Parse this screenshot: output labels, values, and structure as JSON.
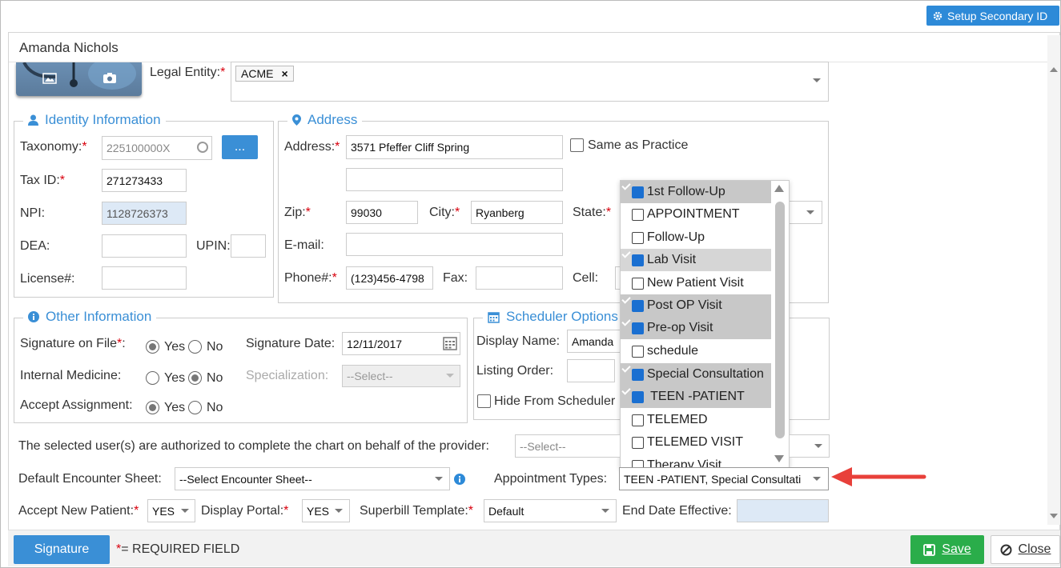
{
  "toolbar": {
    "setup_secondary_id": "Setup Secondary ID"
  },
  "dialog": {
    "title": "Amanda Nichols"
  },
  "legal_entity": {
    "label": "Legal Entity:",
    "required": "*",
    "tag": "ACME",
    "tag_remove": "×"
  },
  "identity": {
    "legend": "Identity Information",
    "taxonomy": {
      "label": "Taxonomy:",
      "value": "225100000X",
      "button": "..."
    },
    "tax_id": {
      "label": "Tax ID:",
      "value": "271273433"
    },
    "npi": {
      "label": "NPI:",
      "value": "1128726373"
    },
    "dea": {
      "label": "DEA:",
      "value": ""
    },
    "upin": {
      "label": "UPIN:",
      "value": ""
    },
    "license": {
      "label": "License#:",
      "value": ""
    }
  },
  "address": {
    "legend": "Address",
    "address": {
      "label": "Address:",
      "value": "3571 Pfeffer Cliff Spring",
      "value2": ""
    },
    "same_as_practice": "Same as Practice",
    "zip": {
      "label": "Zip:",
      "value": "99030"
    },
    "city": {
      "label": "City:",
      "value": "Ryanberg"
    },
    "state": {
      "label": "State:"
    },
    "email": {
      "label": "E-mail:",
      "value": ""
    },
    "phone": {
      "label": "Phone#:",
      "value": "(123)456-4798"
    },
    "fax": {
      "label": "Fax:",
      "value": ""
    },
    "cell": {
      "label": "Cell:"
    }
  },
  "other": {
    "legend": "Other Information",
    "signature_on_file": {
      "label": "Signature on File",
      "selected": "Yes"
    },
    "internal_medicine": {
      "label": "Internal Medicine:",
      "selected": "No"
    },
    "accept_assignment": {
      "label": "Accept Assignment:",
      "selected": "Yes"
    },
    "yes": "Yes",
    "no": "No",
    "signature_date": {
      "label": "Signature Date:",
      "value": "12/11/2017"
    },
    "specialization": {
      "label": "Specialization:",
      "value": "--Select--"
    }
  },
  "scheduler": {
    "legend": "Scheduler Options",
    "display_name": {
      "label": "Display Name:",
      "value": "Amanda"
    },
    "listing_order": {
      "label": "Listing Order:",
      "value": ""
    },
    "hide_from_scheduler": "Hide From Scheduler"
  },
  "appointment_dropdown": {
    "items": [
      {
        "label": "1st Follow-Up",
        "checked": true
      },
      {
        "label": "APPOINTMENT",
        "checked": false
      },
      {
        "label": "Follow-Up",
        "checked": false
      },
      {
        "label": "Lab Visit",
        "checked": true
      },
      {
        "label": "New Patient Visit",
        "checked": false
      },
      {
        "label": "Post OP Visit",
        "checked": true
      },
      {
        "label": "Pre-op Visit",
        "checked": true
      },
      {
        "label": "schedule",
        "checked": false
      },
      {
        "label": "Special Consultation",
        "checked": true
      },
      {
        "label": " TEEN -PATIENT",
        "checked": true
      },
      {
        "label": "TELEMED",
        "checked": false
      },
      {
        "label": "TELEMED VISIT",
        "checked": false
      },
      {
        "label": "Therapy Visit",
        "checked": false
      }
    ]
  },
  "authorized": {
    "label": "The selected user(s) are authorized to complete the chart on behalf of the provider:",
    "value": "--Select--"
  },
  "encounter_sheet": {
    "label": "Default Encounter Sheet:",
    "value": "--Select Encounter Sheet--"
  },
  "appointment_types": {
    "label": "Appointment Types:",
    "value": "TEEN -PATIENT, Special Consultati"
  },
  "accept_new_patient": {
    "label": "Accept New Patient:",
    "value": "YES"
  },
  "display_portal": {
    "label": "Display Portal:",
    "value": "YES"
  },
  "superbill": {
    "label": "Superbill Template:",
    "value": "Default"
  },
  "end_date": {
    "label": "End Date Effective:",
    "value": ""
  },
  "footer": {
    "signature": "Signature",
    "required_marker": "*",
    "required_note": "= REQUIRED FIELD",
    "save": "Save",
    "close": "Close"
  },
  "colors": {
    "primary": "#2d8ad8",
    "save": "#2aad4a",
    "arrow": "#e8403a",
    "legend": "#3a8fd6"
  }
}
